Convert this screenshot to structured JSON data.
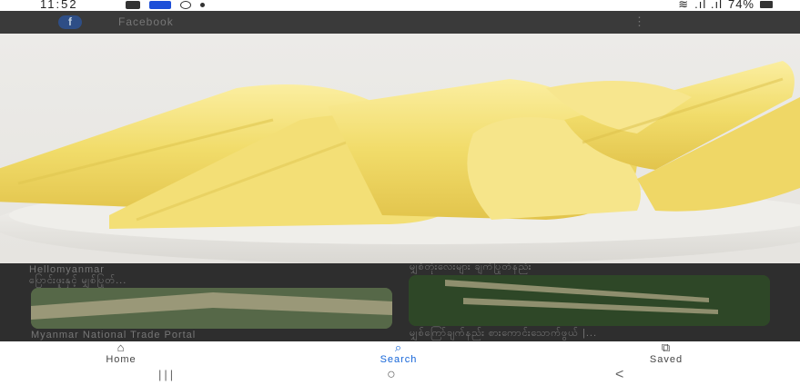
{
  "status_bar": {
    "time": "11:52",
    "battery": "74%",
    "signal_text": ".ıl .ıl"
  },
  "app_bar": {
    "title": "Facebook",
    "menu_glyph": "⋮"
  },
  "results": {
    "left_source": "Hellomyanmar",
    "left_caption": "ပြောင်းဖူးနှင့် မျှစ်ပြုတ်...",
    "left_bottom_source": "Myanmar National Trade Portal",
    "right_top_caption": "မျှစ်တုံးလေးများ ချက်ပြုတ်နည်း",
    "right_bottom_caption": "မျှစ်ကြော်ချက်နည်း စားကောင်းသောက်ဖွယ် |..."
  },
  "bottom_nav": [
    {
      "label": "Home",
      "icon": "home-icon"
    },
    {
      "label": "Search",
      "icon": "search-icon",
      "active": true
    },
    {
      "label": "Saved",
      "icon": "saved-icon"
    }
  ],
  "system_nav": {
    "recents": "|||",
    "home": "○",
    "back": "<"
  },
  "colors": {
    "accent": "#1565d8",
    "bamboo": "#f1dc6a"
  }
}
